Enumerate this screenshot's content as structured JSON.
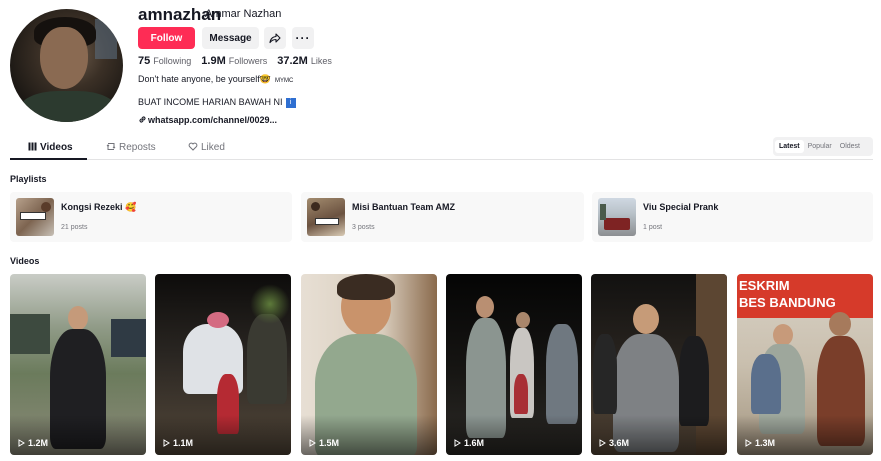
{
  "profile": {
    "username": "amnazhan",
    "nickname": "Ammar Nazhan",
    "follow_label": "Follow",
    "message_label": "Message",
    "more_label": "···",
    "stats": [
      {
        "value": "75",
        "label": "Following"
      },
      {
        "value": "1.9M",
        "label": "Followers"
      },
      {
        "value": "37.2M",
        "label": "Likes"
      }
    ],
    "bio_line1": "Don't hate anyone, be yourself🤓",
    "bio_line1_tag": "MYMC",
    "bio_line2": "BUAT INCOME HARIAN BAWAH NI",
    "bio_line2_icon": "i",
    "link": "whatsapp.com/channel/0029...",
    "icons": {
      "share": "share-arrow-icon",
      "link": "link-icon"
    }
  },
  "tabs": [
    {
      "label": "Videos",
      "icon": "grid-icon",
      "active": true
    },
    {
      "label": "Reposts",
      "icon": "repost-icon",
      "active": false
    },
    {
      "label": "Liked",
      "icon": "heart-outline-icon",
      "active": false
    }
  ],
  "sort_options": [
    {
      "label": "Latest",
      "active": true
    },
    {
      "label": "Popular",
      "active": false
    },
    {
      "label": "Oldest",
      "active": false
    }
  ],
  "playlists_label": "Playlists",
  "playlists": [
    {
      "title": "Kongsi Rezeki 🥰",
      "count": "21 posts"
    },
    {
      "title": "Misi Bantuan Team AMZ",
      "count": "3 posts"
    },
    {
      "title": "Viu Special Prank",
      "count": "1 post"
    }
  ],
  "videos_label": "Videos",
  "videos": [
    {
      "views": "1.2M"
    },
    {
      "views": "1.1M"
    },
    {
      "views": "1.5M"
    },
    {
      "views": "1.6M"
    },
    {
      "views": "3.6M"
    },
    {
      "views": "1.3M"
    }
  ],
  "video6_sign": "ESKRIM\nBES BANDUNG",
  "colors": {
    "accent": "#fe2c55",
    "text": "#161823",
    "muted": "#73747b"
  }
}
